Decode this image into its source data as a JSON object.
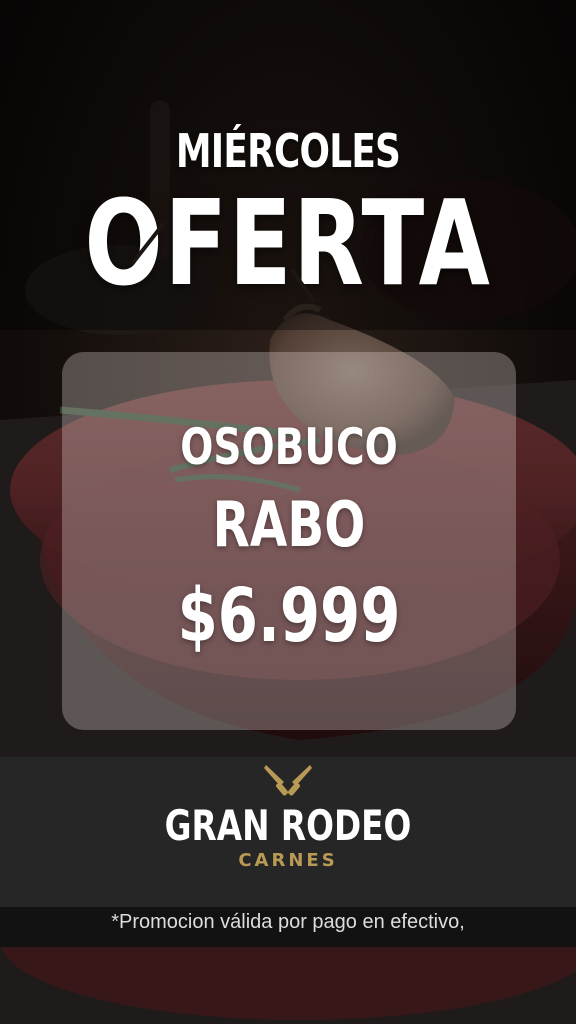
{
  "promo": {
    "weekday": "MIÉRCOLES",
    "title": "OFERTA",
    "product_line_1": "OSOBUCO",
    "product_line_2": "RABO",
    "price": "$6.999"
  },
  "brand": {
    "name": "GRAN RODEO",
    "subtitle": "CARNES",
    "logo_icon": "crossed-knives-icon"
  },
  "footer": {
    "note": "*Promocion válida por pago en efectivo,"
  },
  "colors": {
    "text": "#ffffff",
    "brand_gold": "#b99a55",
    "band": "#262626",
    "background": "#0b0908"
  }
}
